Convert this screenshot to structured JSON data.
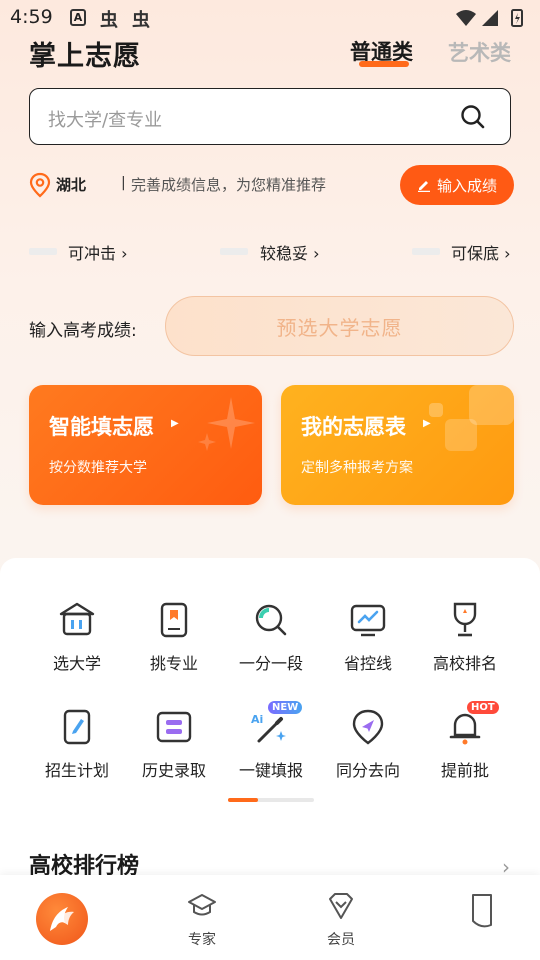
{
  "status_bar": {
    "time": "4:59",
    "a_icon": "A",
    "bug_glyph": "虫"
  },
  "header": {
    "brand": "掌上志愿",
    "tabs": [
      {
        "label": "普通类",
        "active": true
      },
      {
        "label": "艺术类",
        "active": false
      }
    ]
  },
  "search": {
    "placeholder": "找大学/查专业"
  },
  "location": {
    "province": "湖北",
    "separator": "|",
    "hint": "完善成绩信息，为您精准推荐",
    "button_label": "输入成绩"
  },
  "tiers": [
    {
      "label": "可冲击 ›"
    },
    {
      "label": "较稳妥 ›"
    },
    {
      "label": "可保底 ›"
    }
  ],
  "score": {
    "label": "输入高考成绩:",
    "preselect_label": "预选大学志愿"
  },
  "cards": [
    {
      "title": "智能填志愿",
      "arrow": "▶",
      "subtitle": "按分数推荐大学"
    },
    {
      "title": "我的志愿表",
      "arrow": "▶",
      "subtitle": "定制多种报考方案"
    }
  ],
  "grid": [
    {
      "label": "选大学",
      "icon": "university-icon"
    },
    {
      "label": "挑专业",
      "icon": "book-icon"
    },
    {
      "label": "一分一段",
      "icon": "search-ring-icon"
    },
    {
      "label": "省控线",
      "icon": "monitor-chart-icon"
    },
    {
      "label": "高校排名",
      "icon": "trophy-icon"
    },
    {
      "label": "招生计划",
      "icon": "edit-doc-icon"
    },
    {
      "label": "历史录取",
      "icon": "list-card-icon"
    },
    {
      "label": "一键填报",
      "icon": "magic-wand-icon",
      "badge": "NEW",
      "badge_prefix": "Ai"
    },
    {
      "label": "同分去向",
      "icon": "navigation-icon"
    },
    {
      "label": "提前批",
      "icon": "bell-icon",
      "badge": "HOT"
    }
  ],
  "ranking": {
    "title": "高校排行榜",
    "chevron": "›"
  },
  "bottom_nav": [
    {
      "label": "",
      "icon": "home-logo-icon",
      "active": true
    },
    {
      "label": "专家",
      "icon": "graduation-cap-icon"
    },
    {
      "label": "会员",
      "icon": "vip-shield-icon"
    },
    {
      "label": "",
      "icon": "profile-icon"
    }
  ],
  "colors": {
    "accent": "#ff5a14",
    "card_orange": "#ff6a1a",
    "card_amber": "#ffa318"
  }
}
